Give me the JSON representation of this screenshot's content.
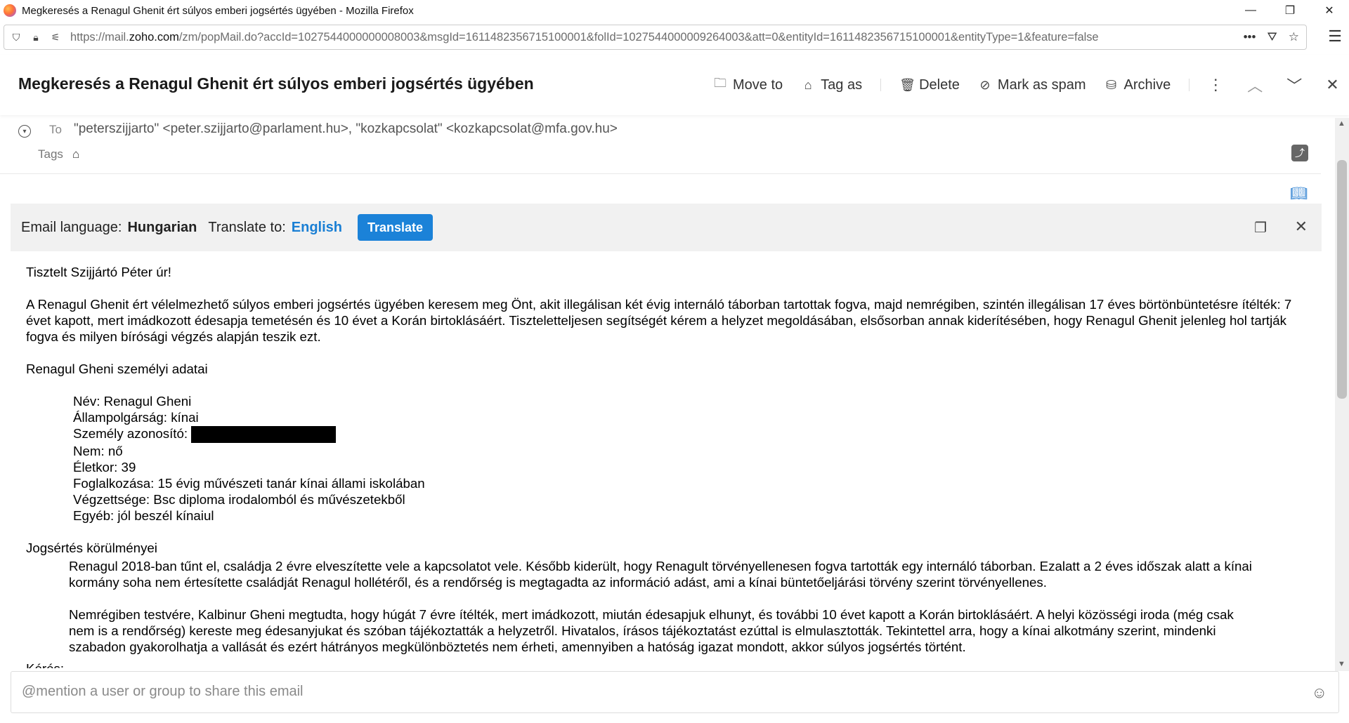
{
  "browser": {
    "window_title": "Megkeresés a Renagul Ghenit ért súlyos emberi jogsértés ügyében - Mozilla Firefox",
    "url_prefix": "https://mail.",
    "url_domain": "zoho.com",
    "url_rest": "/zm/popMail.do?accId=1027544000000008003&msgId=1611482356715100001&folId=1027544000009264003&att=0&entityId=1611482356715100001&entityType=1&feature=false",
    "icons": [
      "shield-icon",
      "lock-icon",
      "permissions-icon",
      "more-dots-icon",
      "pocket-icon",
      "bookmark-star-icon",
      "hamburger-menu-icon"
    ],
    "window_buttons": {
      "minimize": "—",
      "restore": "❐",
      "close": "✕"
    }
  },
  "email": {
    "subject": "Megkeresés a Renagul Ghenit ért súlyos emberi jogsértés ügyében",
    "actions": {
      "move_to": "Move to",
      "tag_as": "Tag as",
      "delete": "Delete",
      "mark_spam": "Mark as spam",
      "archive": "Archive"
    },
    "to_label": "To",
    "to_value": "\"peterszijjarto\" <peter.szijjarto@parlament.hu>, \"kozkapcsolat\" <kozkapcsolat@mfa.gov.hu>",
    "tags_label": "Tags"
  },
  "translate": {
    "language_label": "Email language:",
    "language_value": "Hungarian",
    "to_label": "Translate to:",
    "to_value": "English",
    "button": "Translate"
  },
  "body": {
    "greeting": "Tisztelt Szijjártó Péter úr!",
    "para1": "A Renagul Ghenit ért vélelmezhető súlyos emberi jogsértés ügyében keresem meg Önt, akit illegálisan két évig internáló táborban tartottak fogva, majd nemrégiben, szintén illegálisan 17 éves börtönbüntetésre ítélték: 7 évet kapott, mert imádkozott édesapja temetésén és 10 évet a Korán birtoklásáért. Tiszteletteljesen segítségét kérem a helyzet megoldásában, elsősorban annak kiderítésében, hogy Renagul Ghenit jelenleg hol tartják fogva és milyen bírósági végzés alapján teszik ezt.",
    "personal_heading": "Renagul Gheni személyi adatai",
    "name": "Név: Renagul Gheni",
    "citizenship": "Állampolgárság: kínai",
    "id_label": "Személy azonosító: ",
    "gender": "Nem: nő",
    "age": "Életkor: 39",
    "occupation": "Foglalkozása: 15 évig művészeti tanár kínai állami iskolában",
    "education": "Végzettsége: Bsc diploma irodalomból és művészetekből",
    "other": "Egyéb: jól beszél kínaiul",
    "circumstances_heading": "Jogsértés körülményei",
    "circ1": "Renagul 2018-ban tűnt el, családja 2 évre elveszítette vele a kapcsolatot vele. Később kiderült, hogy Renagult törvényellenesen fogva tartották egy internáló táborban. Ezalatt a 2 éves időszak alatt a kínai kormány soha nem értesítette családját Renagul hollétéről, és a rendőrség is megtagadta az információ adást, ami a kínai büntetőeljárási törvény szerint törvényellenes.",
    "circ2": "Nemrégiben testvére, Kalbinur Gheni megtudta, hogy húgát 7 évre ítélték, mert imádkozott, miután édesapjuk elhunyt, és további 10 évet kapott a Korán birtoklásáért. A helyi közösségi iroda (még csak nem is a rendőrség) kereste meg édesanyjukat és szóban tájékoztatták a helyzetről. Hivatalos, írásos tájékoztatást ezúttal is elmulasztották. Tekintettel arra, hogy a kínai alkotmány szerint, mindenki szabadon gyakorolhatja a vallását és ezért hátrányos megkülönböztetés nem érheti, amennyiben a hatóság igazat mondott, akkor súlyos jogsértés történt.",
    "cut_off": "Kérés:"
  },
  "mention": {
    "placeholder": "@mention a user or group to share this email"
  }
}
